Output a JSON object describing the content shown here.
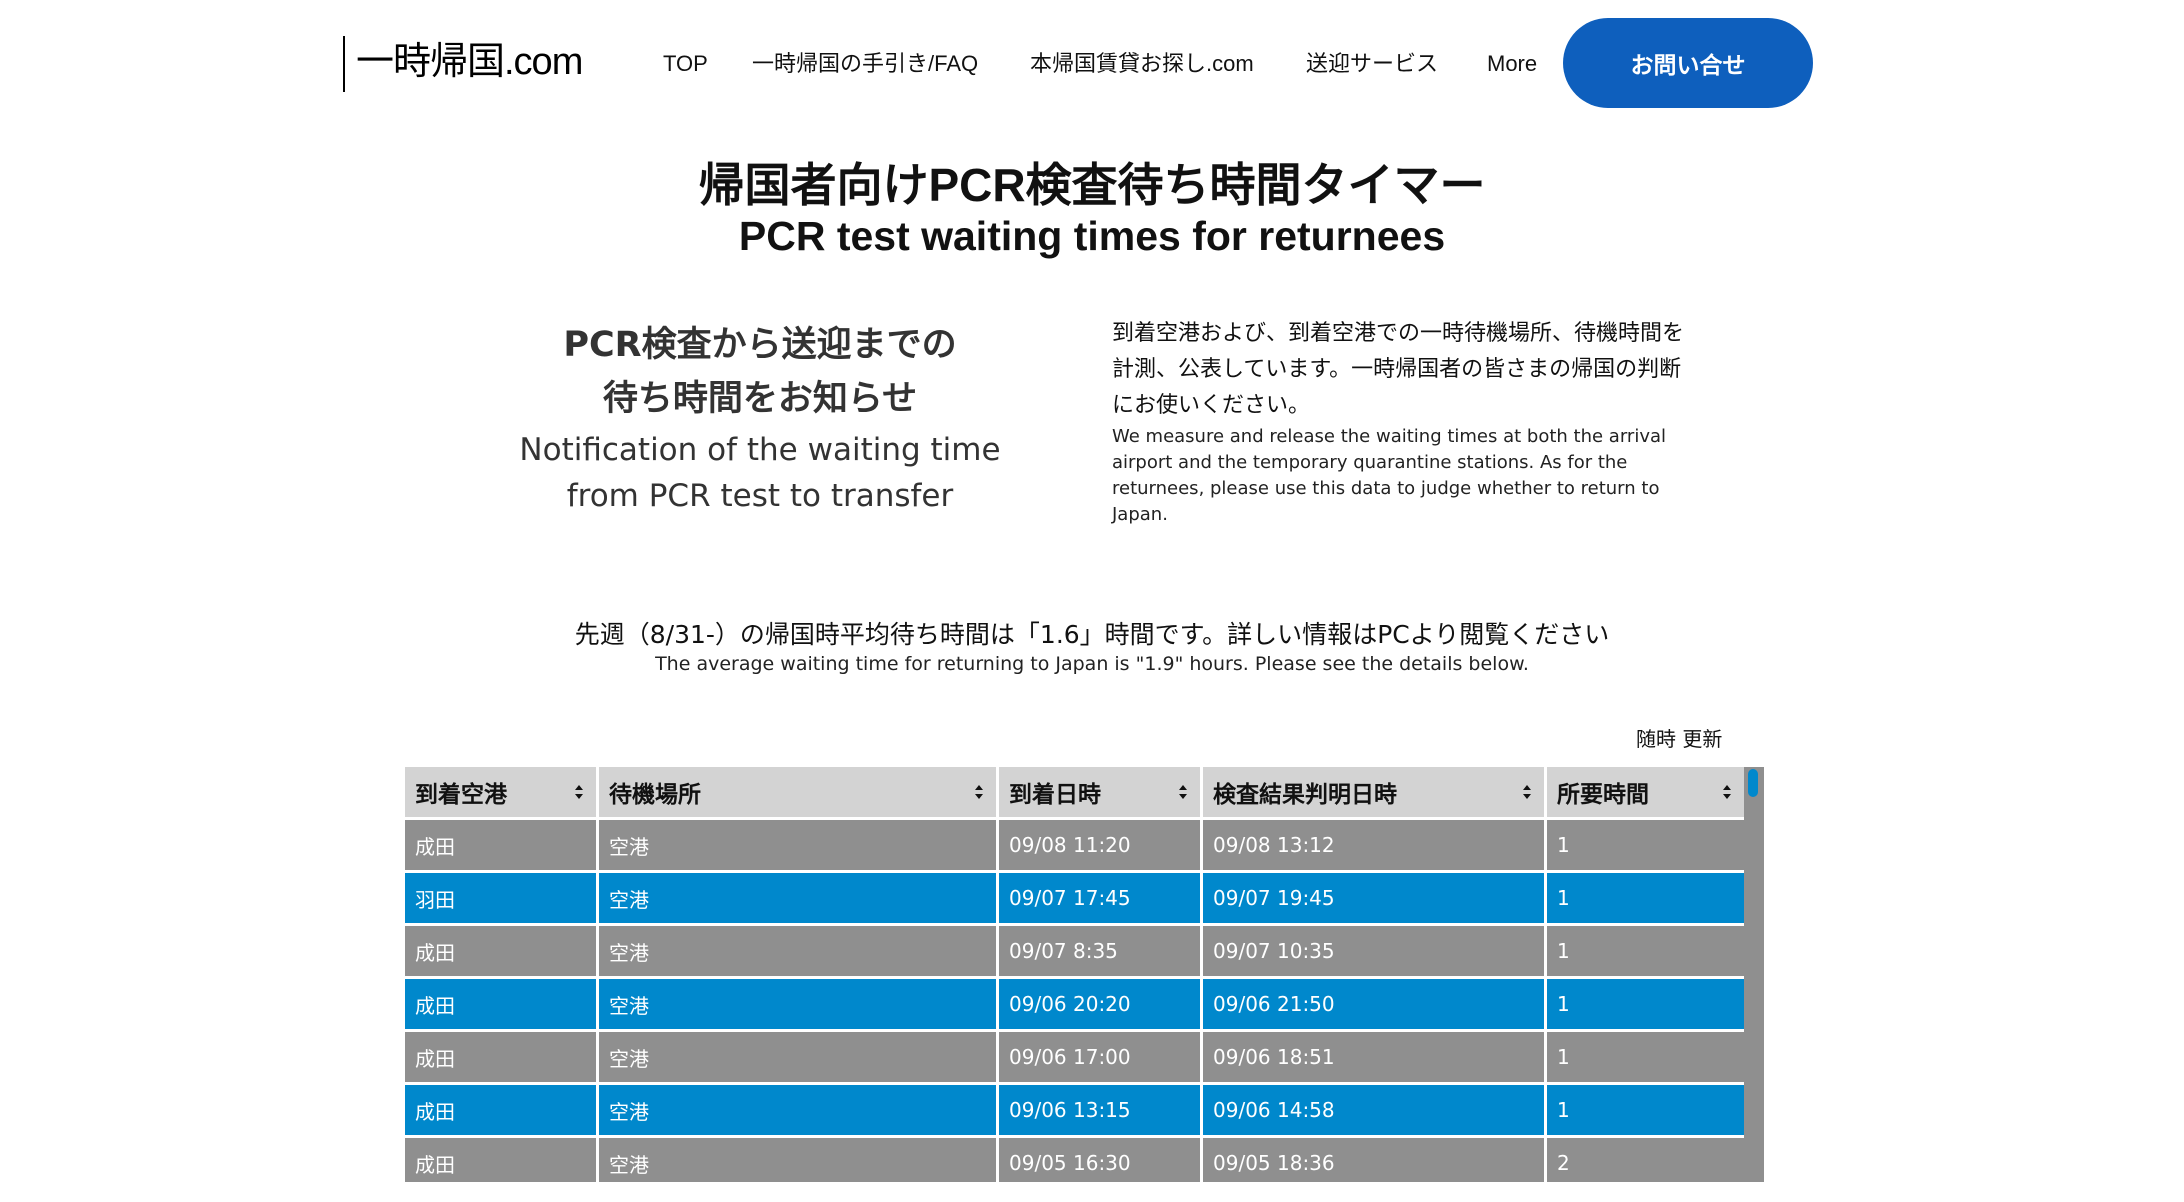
{
  "header": {
    "logo": "一時帰国.com",
    "nav": [
      {
        "label": "TOP"
      },
      {
        "label": "一時帰国の手引き/FAQ"
      },
      {
        "label": "本帰国賃貸お探し.com"
      },
      {
        "label": "送迎サービス"
      },
      {
        "label": "More"
      }
    ],
    "contact_button": "お問い合せ"
  },
  "hero": {
    "title_ja": "帰国者向けPCR検査待ち時間タイマー",
    "title_en": "PCR test waiting times for returnees"
  },
  "intro_left": {
    "ja_line1": "PCR検査から送迎までの",
    "ja_line2": "待ち時間をお知らせ",
    "en_line1": "Notification of the waiting time",
    "en_line2": "from PCR test to transfer"
  },
  "intro_right": {
    "ja": "到着空港および、到着空港での一時待機場所、待機時間を計測、公表しています。一時帰国者の皆さまの帰国の判断にお使いください。",
    "en": "We measure and release the waiting times at both the arrival airport and the temporary quarantine stations. As for the returnees, please use this data to judge whether to return to Japan."
  },
  "notice": {
    "ja": "先週（8/31-）の帰国時平均待ち時間は「1.6」時間です。詳しい情報はPCより閲覧ください",
    "en": "The average waiting time for returning to Japan is \"1.9\" hours.  Please see the details below."
  },
  "update_note": "随時 更新",
  "table": {
    "columns": [
      "到着空港",
      "待機場所",
      "到着日時",
      "検査結果判明日時",
      "所要時間"
    ],
    "rows": [
      [
        "成田",
        "空港",
        "09/08 11:20",
        "09/08 13:12",
        "1"
      ],
      [
        "羽田",
        "空港",
        "09/07 17:45",
        "09/07 19:45",
        "1"
      ],
      [
        "成田",
        "空港",
        "09/07 8:35",
        "09/07 10:35",
        "1"
      ],
      [
        "成田",
        "空港",
        "09/06 20:20",
        "09/06 21:50",
        "1"
      ],
      [
        "成田",
        "空港",
        "09/06 17:00",
        "09/06 18:51",
        "1"
      ],
      [
        "成田",
        "空港",
        "09/06 13:15",
        "09/06 14:58",
        "1"
      ],
      [
        "成田",
        "空港",
        "09/05 16:30",
        "09/05 18:36",
        "2"
      ]
    ]
  },
  "colors": {
    "accent_button": "#0e5fbd",
    "row_highlight": "#0088cc",
    "row_default": "#8f8f8f",
    "header_bg": "#d3d3d3"
  }
}
